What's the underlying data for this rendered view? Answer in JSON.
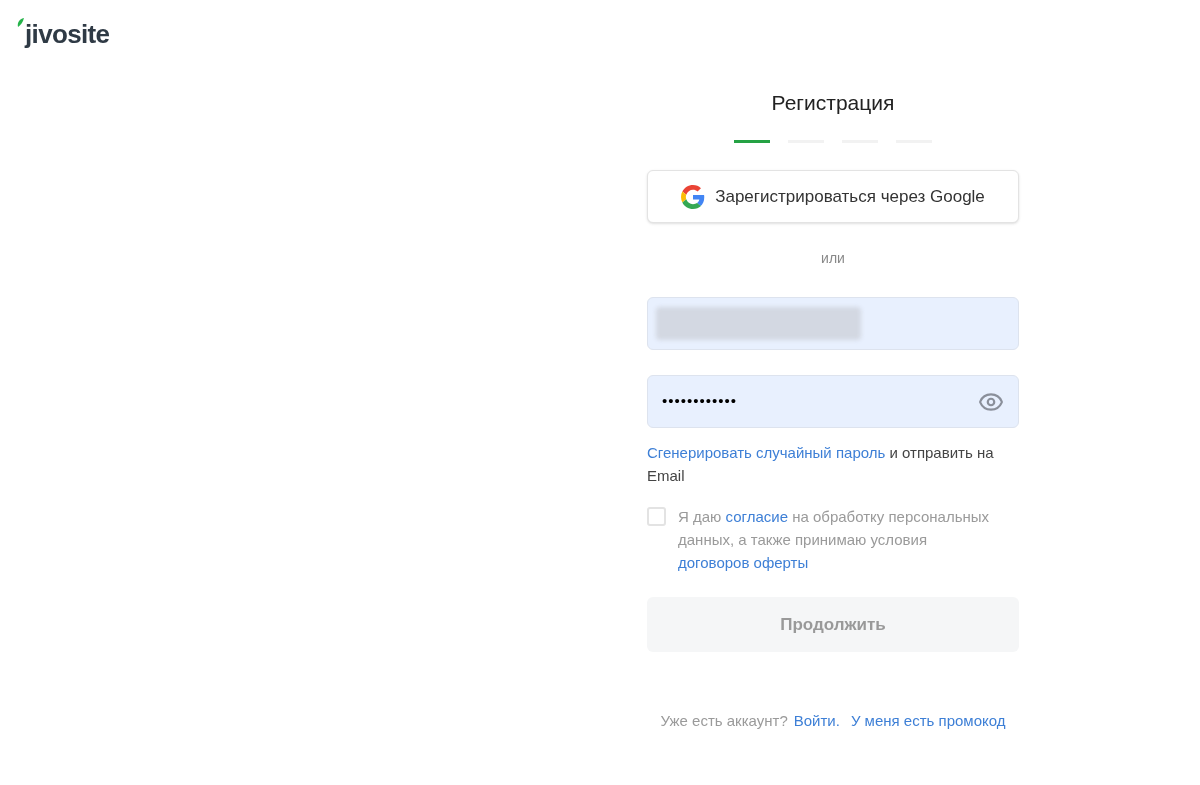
{
  "logo": {
    "text": "jivosite"
  },
  "title": "Регистрация",
  "steps": [
    {
      "selected": true
    },
    {
      "selected": false
    },
    {
      "selected": false
    },
    {
      "selected": false
    }
  ],
  "google_button": {
    "label": "Зарегистрироваться через Google"
  },
  "divider_text": "или",
  "password_field": {
    "value": "••••••••••••"
  },
  "password_hint": [
    {
      "text": "Сгенерировать случайный пароль",
      "link": true
    },
    {
      "text": " и отправить на Email",
      "link": false
    }
  ],
  "consent": {
    "checked": false,
    "parts": [
      {
        "text": "Я даю ",
        "link": false
      },
      {
        "text": "согласие",
        "link": true
      },
      {
        "text": " на обработку персональных данных, а также принимаю условия ",
        "link": false
      },
      {
        "text": "договоров ",
        "link": true
      },
      {
        "text": "оферты",
        "link": true
      }
    ]
  },
  "continue_button": {
    "label": "Продолжить",
    "disabled": true
  },
  "footer": [
    {
      "text": "Уже есть аккаунт?",
      "link": false
    },
    {
      "text": "Войти.",
      "link": true
    },
    {
      "text": "У меня есть промокод",
      "link": true
    }
  ]
}
